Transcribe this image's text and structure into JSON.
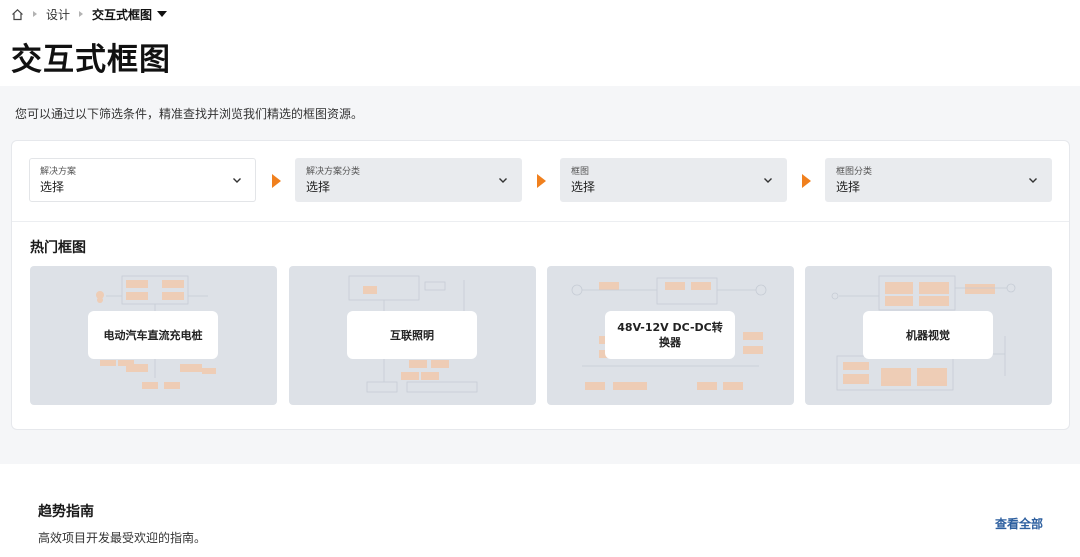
{
  "breadcrumb": {
    "items": [
      "设计",
      "交互式框图"
    ]
  },
  "page": {
    "title": "交互式框图",
    "intro": "您可以通过以下筛选条件，精准查找并浏览我们精选的框图资源。"
  },
  "filters": [
    {
      "label": "解决方案",
      "value": "选择"
    },
    {
      "label": "解决方案分类",
      "value": "选择"
    },
    {
      "label": "框图",
      "value": "选择"
    },
    {
      "label": "框图分类",
      "value": "选择"
    }
  ],
  "hot": {
    "title": "热门框图",
    "cards": [
      {
        "title": "电动汽车直流充电桩"
      },
      {
        "title": "互联照明"
      },
      {
        "title": "48V-12V DC-DC转换器"
      },
      {
        "title": "机器视觉"
      }
    ]
  },
  "trends": {
    "title": "趋势指南",
    "subtitle": "高效项目开发最受欢迎的指南。",
    "view_all": "查看全部"
  },
  "colors": {
    "accent_arrow": "#f0801e",
    "link": "#2d5f9f",
    "card_bg": "#dde1e7",
    "diagram_block": "#f1c9ad"
  }
}
